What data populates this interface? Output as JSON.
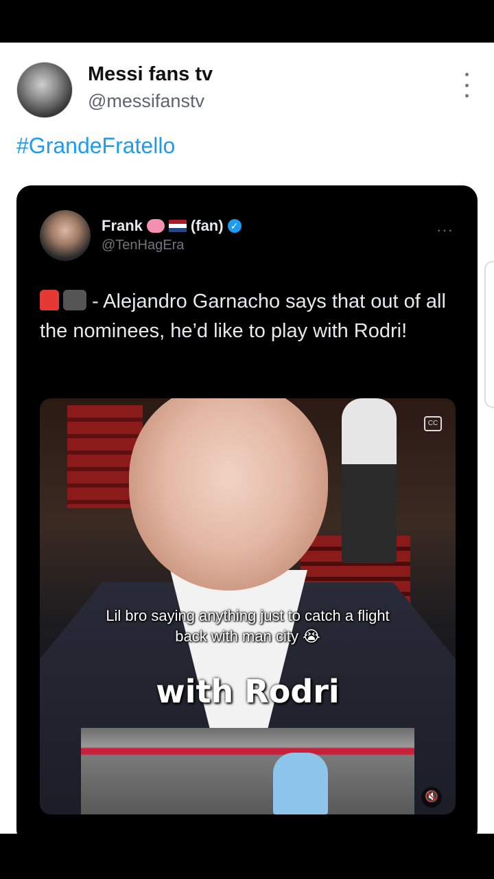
{
  "tweet": {
    "author_name": "Messi fans tv",
    "author_handle": "@messifanstv",
    "text": "#GrandeFratello"
  },
  "quoted_tweet": {
    "author_name": "Frank",
    "author_suffix": "(fan)",
    "author_handle": "@TenHagEra",
    "more_label": "···",
    "text": "- Alejandro Garnacho says that out of all the nominees, he’d like to play with Rodri!"
  },
  "video": {
    "caption_line1": "Lil bro saying anything just to catch a flight",
    "caption_line2": "back with man city 😭",
    "overlay_text": "with Rodri",
    "cc_label": "CC",
    "mute_label": "🔇"
  },
  "colors": {
    "link": "#1d9bf0",
    "embed_bg": "#000000",
    "verified": "#1d9bf0"
  },
  "icons": [
    "avatar",
    "more-icon",
    "brain-icon",
    "netherlands-flag-icon",
    "verified-icon",
    "siren-icon",
    "camera-icon",
    "cc-icon",
    "mute-icon"
  ]
}
